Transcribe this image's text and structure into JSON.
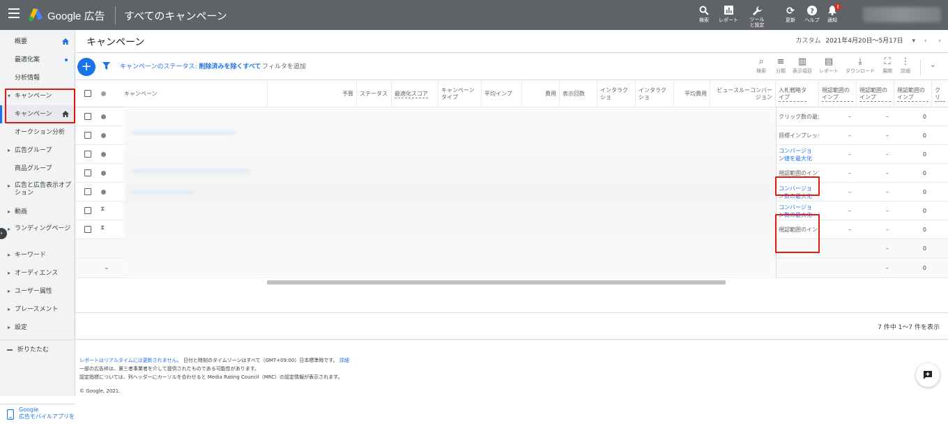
{
  "app": {
    "brand": "Google 広告",
    "title": "すべてのキャンペーン"
  },
  "topbar": {
    "items": [
      {
        "icon": "search-icon",
        "label": "検索"
      },
      {
        "icon": "report-icon",
        "label": "レポート"
      },
      {
        "icon": "wrench-icon",
        "label": "ツールと設定"
      },
      {
        "icon": "refresh-icon",
        "label": "更新"
      },
      {
        "icon": "help-icon",
        "label": "ヘルプ"
      },
      {
        "icon": "bell-icon",
        "label": "通知",
        "badge": "!"
      }
    ]
  },
  "sidebar": {
    "items": [
      {
        "label": "概要"
      },
      {
        "label": "最適化案"
      },
      {
        "label": "分析情報"
      },
      {
        "label": "キャンペーン"
      },
      {
        "label": "キャンペーン"
      },
      {
        "label": "オークション分析"
      },
      {
        "label": "広告グループ"
      },
      {
        "label": "商品グループ"
      },
      {
        "label": "広告と広告表示オプション"
      },
      {
        "label": "動画"
      },
      {
        "label": "ランディングページ"
      },
      {
        "label": "キーワード"
      },
      {
        "label": "オーディエンス"
      },
      {
        "label": "ユーザー属性"
      },
      {
        "label": "プレースメント"
      },
      {
        "label": "設定"
      },
      {
        "label": "折りたたむ"
      }
    ],
    "mobile": {
      "line1": "Google",
      "line2": "広告モバイルアプリを"
    }
  },
  "page": {
    "title": "キャンペーン",
    "date_label": "カスタム",
    "date_range": "2021年4月20日～5月17日"
  },
  "filter": {
    "status_label": "キャンペーンのステータス:",
    "status_value": "削除済みを除くすべて",
    "add": "フィルタを追加"
  },
  "tools": [
    {
      "icon": "search-icon",
      "label": "検索"
    },
    {
      "icon": "segment-icon",
      "label": "分類"
    },
    {
      "icon": "columns-icon",
      "label": "表示項目"
    },
    {
      "icon": "report-icon",
      "label": "レポート"
    },
    {
      "icon": "download-icon",
      "label": "ダウンロード"
    },
    {
      "icon": "expand-icon",
      "label": "展開"
    },
    {
      "icon": "more-icon",
      "label": "詳細"
    }
  ],
  "table": {
    "headers": {
      "campaign": "キャンペーン",
      "budget": "予算",
      "status": "ステータス",
      "opt_score": "最適化スコア",
      "campaign_type": "キャンペーンタイプ",
      "avg_imp": "平均インプ",
      "cost": "費用",
      "impressions": "表示回数",
      "interactions1": "インタラクショ",
      "interactions2": "インタラクショ",
      "avg_cost": "平均費用",
      "view_conv": "ビュースルーコンバージョン",
      "bid_type": "入札戦略タイプ",
      "vis1": "視認範囲のインプ",
      "vis2": "視認範囲のインプ",
      "vis3": "視認範囲のインプ",
      "click": "クリ"
    },
    "rows": [
      {
        "bid": "クリック数の最大化",
        "v1": "–",
        "v2": "–",
        "v3": "0"
      },
      {
        "bid": "目標インプレッション",
        "v1": "–",
        "v2": "–",
        "v3": "0"
      },
      {
        "bid": "コンバージョン値を最大化",
        "v1": "–",
        "v2": "–",
        "v3": "0"
      },
      {
        "bid": "視認範囲のインプレッション",
        "v1": "–",
        "v2": "–",
        "v3": "0"
      },
      {
        "bid": "コンバージョン数の最大化",
        "v1": "–",
        "v2": "–",
        "v3": "0"
      },
      {
        "bid": "コンバージョン数の最大化",
        "v1": "–",
        "v2": "–",
        "v3": "0"
      },
      {
        "bid": "視認範囲のインプレッション",
        "v1": "–",
        "v2": "–",
        "v3": "0"
      }
    ],
    "totals": [
      {
        "v2": "–",
        "v3": "0"
      },
      {
        "v2": "–",
        "v3": "0"
      }
    ],
    "pager": "7 件中 1～7 件を表示"
  },
  "footer": {
    "line1_link": "レポートはリアルタイムには更新されません。",
    "line1_rest": "日付と時刻のタイムゾーンはすべて（GMT+09:00）日本標準時です。",
    "line1_more": "詳細",
    "line2": "一部の広告枠は、第三者事業者を介して提供されたものである可能性があります。",
    "line3": "認定指標については、列ヘッダーにカーソルを合わせると Media Rating Council（MRC）の認定情報が表示されます。",
    "copyright": "© Google, 2021."
  }
}
